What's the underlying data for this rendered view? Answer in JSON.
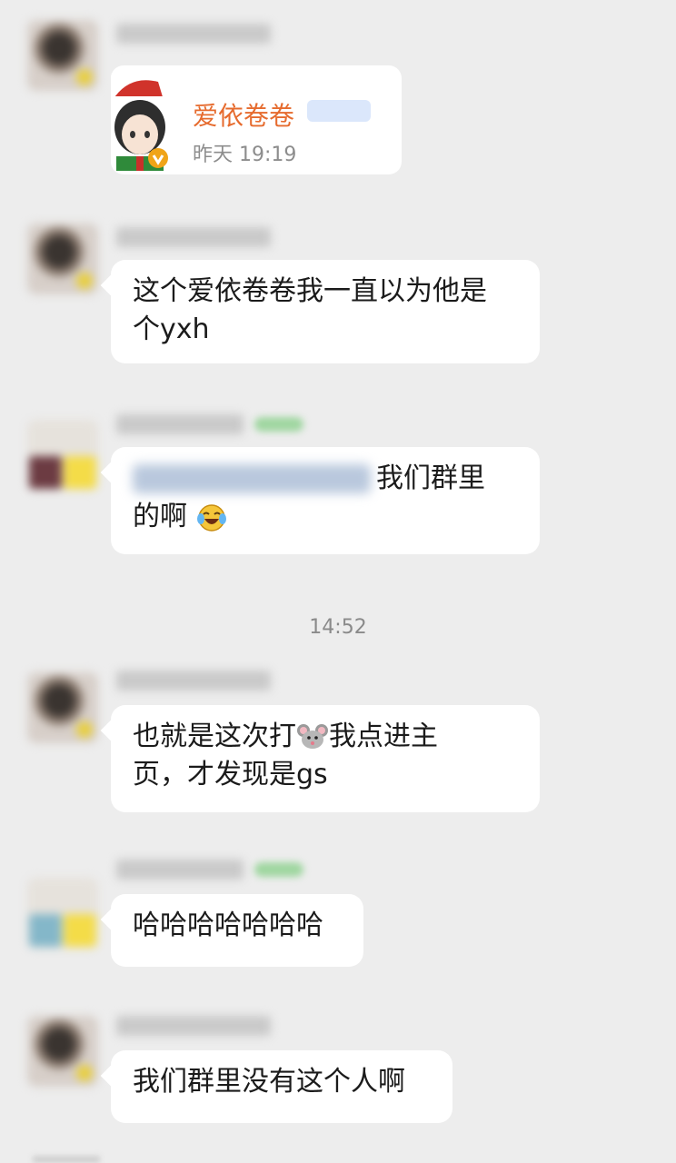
{
  "timestamp": "14:52",
  "card": {
    "name": "爱依卷卷",
    "time": "昨天 19:19"
  },
  "messages": [
    {
      "text_line1": "这个爱依卷卷我一直以为他是",
      "text_line2": "个yxh"
    },
    {
      "text_after_mention": "我们群里",
      "text_line2": "的啊"
    },
    {
      "text_part1": "也就是这次打",
      "text_part2": "我点进主",
      "text_line2": "页，才发现是gs"
    },
    {
      "text": "哈哈哈哈哈哈哈"
    },
    {
      "text": "我们群里没有这个人啊"
    }
  ],
  "icons": {
    "laughing_emoji": "laughing-crying-emoji",
    "mouse_emoji": "mouse-face-emoji"
  }
}
